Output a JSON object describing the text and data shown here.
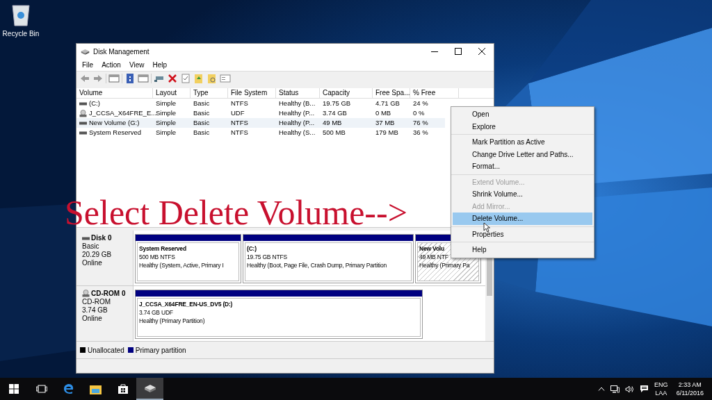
{
  "desktop_icons": [
    {
      "label": "Recycle Bin"
    }
  ],
  "window": {
    "title": "Disk Management",
    "menu": [
      "File",
      "Action",
      "View",
      "Help"
    ],
    "table": {
      "columns": [
        "Volume",
        "Layout",
        "Type",
        "File System",
        "Status",
        "Capacity",
        "Free Spa...",
        "% Free"
      ],
      "rows": [
        {
          "kind": "disk",
          "selected": false,
          "cells": [
            "(C:)",
            "Simple",
            "Basic",
            "NTFS",
            "Healthy (B...",
            "19.75 GB",
            "4.71 GB",
            "24 %"
          ]
        },
        {
          "kind": "cd",
          "selected": false,
          "cells": [
            "J_CCSA_X64FRE_E...",
            "Simple",
            "Basic",
            "UDF",
            "Healthy (P...",
            "3.74 GB",
            "0 MB",
            "0 %"
          ]
        },
        {
          "kind": "disk",
          "selected": true,
          "cells": [
            "New Volume (G:)",
            "Simple",
            "Basic",
            "NTFS",
            "Healthy (P...",
            "49 MB",
            "37 MB",
            "76 %"
          ]
        },
        {
          "kind": "disk",
          "selected": false,
          "cells": [
            "System Reserved",
            "Simple",
            "Basic",
            "NTFS",
            "Healthy (S...",
            "500 MB",
            "179 MB",
            "36 %"
          ]
        }
      ]
    },
    "disks": [
      {
        "kind": "disk",
        "name": "Disk 0",
        "type": "Basic",
        "size": "20.29 GB",
        "status": "Online",
        "partitions": [
          {
            "title": "System Reserved",
            "detail": "500 MB NTFS",
            "health": "Healthy (System, Active, Primary I",
            "selected": false
          },
          {
            "title": "(C:)",
            "detail": "19.75 GB NTFS",
            "health": "Healthy (Boot, Page File, Crash Dump, Primary Partition",
            "selected": false
          },
          {
            "title": "New Volu",
            "detail": "49 MB NTF",
            "health": "Healthy (Primary Pa",
            "selected": true
          }
        ]
      },
      {
        "kind": "cd",
        "name": "CD-ROM 0",
        "type": "CD-ROM",
        "size": "3.74 GB",
        "status": "Online",
        "partitions": [
          {
            "title": "J_CCSA_X64FRE_EN-US_DV5  (D:)",
            "detail": "3.74 GB UDF",
            "health": "Healthy (Primary Partition)",
            "selected": false
          }
        ]
      }
    ],
    "legend": [
      {
        "label": "Unallocated",
        "color": "#000000"
      },
      {
        "label": "Primary partition",
        "color": "#000080"
      }
    ]
  },
  "context_menu": {
    "groups": [
      [
        {
          "label": "Open",
          "disabled": false,
          "selected": false
        },
        {
          "label": "Explore",
          "disabled": false,
          "selected": false
        }
      ],
      [
        {
          "label": "Mark Partition as Active",
          "disabled": false,
          "selected": false
        },
        {
          "label": "Change Drive Letter and Paths...",
          "disabled": false,
          "selected": false
        },
        {
          "label": "Format...",
          "disabled": false,
          "selected": false
        }
      ],
      [
        {
          "label": "Extend Volume...",
          "disabled": true,
          "selected": false
        },
        {
          "label": "Shrink Volume...",
          "disabled": false,
          "selected": false
        },
        {
          "label": "Add Mirror...",
          "disabled": true,
          "selected": false
        },
        {
          "label": "Delete Volume...",
          "disabled": false,
          "selected": true
        }
      ],
      [
        {
          "label": "Properties",
          "disabled": false,
          "selected": false
        }
      ],
      [
        {
          "label": "Help",
          "disabled": false,
          "selected": false
        }
      ]
    ]
  },
  "annotation": "Select Delete Volume-->",
  "taskbar": {
    "apps": [
      {
        "kind": "taskview",
        "selected": false
      },
      {
        "kind": "edge",
        "selected": false
      },
      {
        "kind": "explorer",
        "selected": false
      },
      {
        "kind": "store",
        "selected": false
      },
      {
        "kind": "diskmgmt",
        "selected": true
      }
    ],
    "language": "ENG",
    "layout": "LAA",
    "time": "2:33 AM",
    "date": "6/11/2016"
  }
}
